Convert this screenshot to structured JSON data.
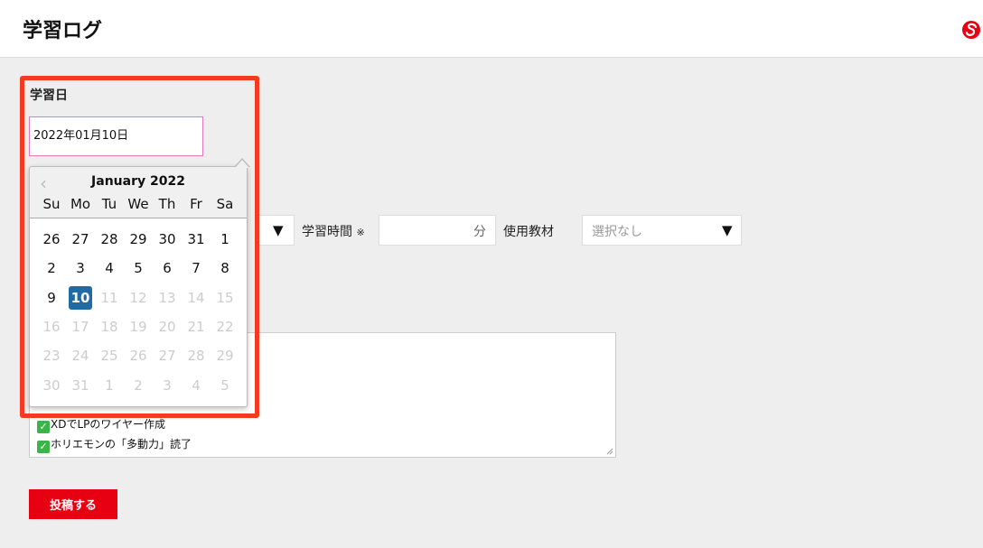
{
  "header": {
    "title": "学習ログ",
    "logo_icon": "brand-logo-icon"
  },
  "study_date": {
    "label": "学習日",
    "value": "2022年01月10日"
  },
  "datepicker": {
    "month_label": "January 2022",
    "prev_icon": "chevron-left-icon",
    "weekdays": [
      "Su",
      "Mo",
      "Tu",
      "We",
      "Th",
      "Fr",
      "Sa"
    ],
    "weeks": [
      [
        "26",
        "27",
        "28",
        "29",
        "30",
        "31",
        "1"
      ],
      [
        "2",
        "3",
        "4",
        "5",
        "6",
        "7",
        "8"
      ],
      [
        "9",
        "10",
        "11",
        "12",
        "13",
        "14",
        "15"
      ],
      [
        "16",
        "17",
        "18",
        "19",
        "20",
        "21",
        "22"
      ],
      [
        "23",
        "24",
        "25",
        "26",
        "27",
        "28",
        "29"
      ],
      [
        "30",
        "31",
        "1",
        "2",
        "3",
        "4",
        "5"
      ]
    ],
    "selected_day": "10",
    "selected_color": "#216ba5"
  },
  "form": {
    "time_label": "学習時間",
    "time_required_mark": "※",
    "time_unit": "分",
    "material_label": "使用教材",
    "material_placeholder": "選択なし",
    "dropdown_arrow": "▼"
  },
  "notes": {
    "check_icon": "check-mark-icon",
    "check_glyph": "✓",
    "lines": [
      "XDでLPのワイヤー作成",
      "ホリエモンの「多動力」読了"
    ]
  },
  "submit_label": "投稿する",
  "colors": {
    "brand_red": "#e60012",
    "highlight": "#f53a22"
  }
}
